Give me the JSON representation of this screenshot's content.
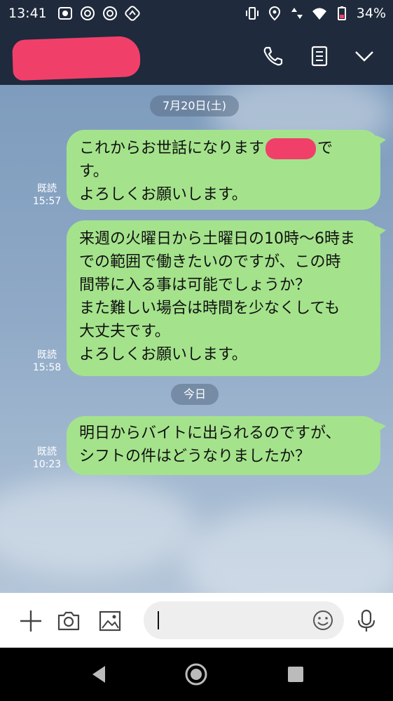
{
  "status_bar": {
    "time": "13:41",
    "battery": "34%",
    "icons_left": [
      "notification-icon",
      "at-icon",
      "at-icon",
      "sync-icon"
    ],
    "icons_right": [
      "vibrate-icon",
      "location-icon",
      "data-icon",
      "wifi-icon",
      "battery-icon"
    ]
  },
  "header": {
    "title_redacted": true,
    "buttons": [
      "call-icon",
      "notes-icon",
      "chevron-down-icon"
    ]
  },
  "chat": {
    "date_1": "7月20日(土)",
    "date_2": "今日",
    "messages": [
      {
        "lines": [
          "これからお世話になります",
          "です。",
          "す。",
          "よろしくお願いします。"
        ],
        "read_label": "既読",
        "time": "15:57"
      },
      {
        "lines": [
          "来週の火曜日から土曜日の10時〜6時ま",
          "での範囲で働きたいのですが、この時",
          "間帯に入る事は可能でしょうか？",
          "また難しい場合は時間を少なくしても",
          "大丈夫です。",
          "よろしくお願いします。"
        ],
        "read_label": "既読",
        "time": "15:58"
      },
      {
        "lines": [
          "明日からバイトに出られるのですが、",
          "シフトの件はどうなりましたか？"
        ],
        "read_label": "既読",
        "time": "10:23"
      }
    ]
  },
  "input_bar": {
    "value": "",
    "icons": [
      "plus-icon",
      "camera-icon",
      "image-icon",
      "emoji-icon",
      "mic-icon"
    ]
  },
  "colors": {
    "header_bg": "#1f2a3c",
    "bubble_bg": "#a4e38c",
    "redaction": "#f0406a"
  }
}
